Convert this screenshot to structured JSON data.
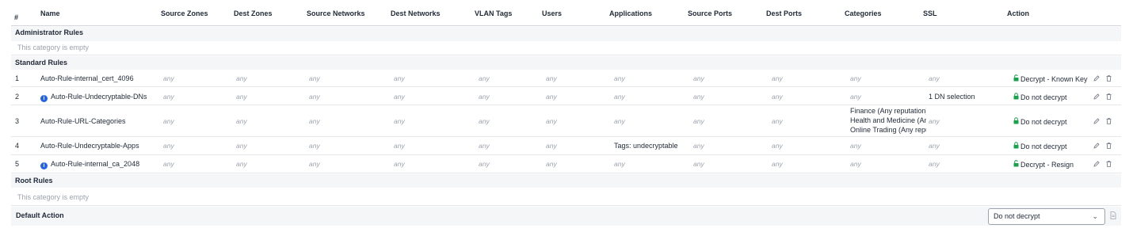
{
  "columns": {
    "num": "#",
    "name": "Name",
    "source_zones": "Source Zones",
    "dest_zones": "Dest Zones",
    "source_networks": "Source Networks",
    "dest_networks": "Dest Networks",
    "vlan_tags": "VLAN Tags",
    "users": "Users",
    "applications": "Applications",
    "source_ports": "Source Ports",
    "dest_ports": "Dest Ports",
    "categories": "Categories",
    "ssl": "SSL",
    "action": "Action"
  },
  "any_label": "any",
  "sections": {
    "admin": {
      "title": "Administrator Rules",
      "empty": "This category is empty"
    },
    "standard": {
      "title": "Standard Rules"
    },
    "root": {
      "title": "Root Rules",
      "empty": "This category is empty"
    }
  },
  "rules": [
    {
      "num": "1",
      "name": "Auto-Rule-internal_cert_4096",
      "info": false,
      "applications": "any",
      "categories": [
        "any"
      ],
      "ssl": "any",
      "action": "Decrypt - Known Key",
      "action_icon": "unlock-icon",
      "action_color": "#16a34a"
    },
    {
      "num": "2",
      "name": "Auto-Rule-Undecryptable-DNs",
      "info": true,
      "applications": "any",
      "categories": [
        "any"
      ],
      "ssl": "1 DN selection",
      "action": "Do not decrypt",
      "action_icon": "lock-icon",
      "action_color": "#16a34a"
    },
    {
      "num": "3",
      "name": "Auto-Rule-URL-Categories",
      "info": false,
      "applications": "any",
      "categories": [
        "Finance (Any reputation)",
        "Health and Medicine (Any reputation)",
        "Online Trading (Any reputation)"
      ],
      "ssl": "any",
      "action": "Do not decrypt",
      "action_icon": "lock-icon",
      "action_color": "#16a34a"
    },
    {
      "num": "4",
      "name": "Auto-Rule-Undecryptable-Apps",
      "info": false,
      "applications": "Tags: undecryptable",
      "categories": [
        "any"
      ],
      "ssl": "any",
      "action": "Do not decrypt",
      "action_icon": "lock-icon",
      "action_color": "#16a34a"
    },
    {
      "num": "5",
      "name": "Auto-Rule-internal_ca_2048",
      "info": true,
      "applications": "any",
      "categories": [
        "any"
      ],
      "ssl": "any",
      "action": "Decrypt - Resign",
      "action_icon": "unlock-icon",
      "action_color": "#16a34a"
    }
  ],
  "default_action": {
    "label": "Default Action",
    "value": "Do not decrypt"
  },
  "colors": {
    "info_badge": "#2563eb",
    "any_text": "#9ca3af",
    "shade": "#f5f6f7"
  }
}
